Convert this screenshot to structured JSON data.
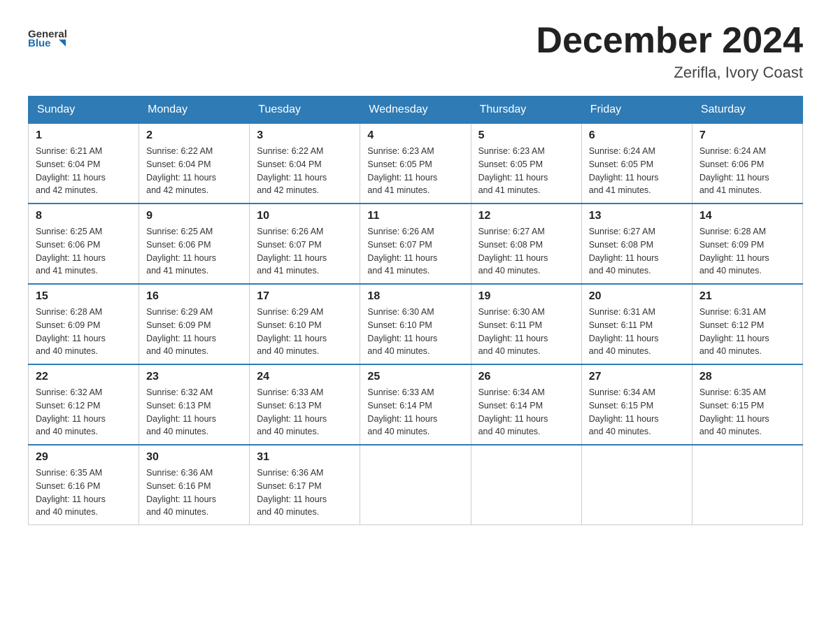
{
  "header": {
    "logo_text_general": "General",
    "logo_text_blue": "Blue",
    "calendar_title": "December 2024",
    "calendar_subtitle": "Zerifla, Ivory Coast"
  },
  "days_of_week": [
    "Sunday",
    "Monday",
    "Tuesday",
    "Wednesday",
    "Thursday",
    "Friday",
    "Saturday"
  ],
  "weeks": [
    [
      {
        "day": "1",
        "sunrise": "6:21 AM",
        "sunset": "6:04 PM",
        "daylight": "11 hours and 42 minutes."
      },
      {
        "day": "2",
        "sunrise": "6:22 AM",
        "sunset": "6:04 PM",
        "daylight": "11 hours and 42 minutes."
      },
      {
        "day": "3",
        "sunrise": "6:22 AM",
        "sunset": "6:04 PM",
        "daylight": "11 hours and 42 minutes."
      },
      {
        "day": "4",
        "sunrise": "6:23 AM",
        "sunset": "6:05 PM",
        "daylight": "11 hours and 41 minutes."
      },
      {
        "day": "5",
        "sunrise": "6:23 AM",
        "sunset": "6:05 PM",
        "daylight": "11 hours and 41 minutes."
      },
      {
        "day": "6",
        "sunrise": "6:24 AM",
        "sunset": "6:05 PM",
        "daylight": "11 hours and 41 minutes."
      },
      {
        "day": "7",
        "sunrise": "6:24 AM",
        "sunset": "6:06 PM",
        "daylight": "11 hours and 41 minutes."
      }
    ],
    [
      {
        "day": "8",
        "sunrise": "6:25 AM",
        "sunset": "6:06 PM",
        "daylight": "11 hours and 41 minutes."
      },
      {
        "day": "9",
        "sunrise": "6:25 AM",
        "sunset": "6:06 PM",
        "daylight": "11 hours and 41 minutes."
      },
      {
        "day": "10",
        "sunrise": "6:26 AM",
        "sunset": "6:07 PM",
        "daylight": "11 hours and 41 minutes."
      },
      {
        "day": "11",
        "sunrise": "6:26 AM",
        "sunset": "6:07 PM",
        "daylight": "11 hours and 41 minutes."
      },
      {
        "day": "12",
        "sunrise": "6:27 AM",
        "sunset": "6:08 PM",
        "daylight": "11 hours and 40 minutes."
      },
      {
        "day": "13",
        "sunrise": "6:27 AM",
        "sunset": "6:08 PM",
        "daylight": "11 hours and 40 minutes."
      },
      {
        "day": "14",
        "sunrise": "6:28 AM",
        "sunset": "6:09 PM",
        "daylight": "11 hours and 40 minutes."
      }
    ],
    [
      {
        "day": "15",
        "sunrise": "6:28 AM",
        "sunset": "6:09 PM",
        "daylight": "11 hours and 40 minutes."
      },
      {
        "day": "16",
        "sunrise": "6:29 AM",
        "sunset": "6:09 PM",
        "daylight": "11 hours and 40 minutes."
      },
      {
        "day": "17",
        "sunrise": "6:29 AM",
        "sunset": "6:10 PM",
        "daylight": "11 hours and 40 minutes."
      },
      {
        "day": "18",
        "sunrise": "6:30 AM",
        "sunset": "6:10 PM",
        "daylight": "11 hours and 40 minutes."
      },
      {
        "day": "19",
        "sunrise": "6:30 AM",
        "sunset": "6:11 PM",
        "daylight": "11 hours and 40 minutes."
      },
      {
        "day": "20",
        "sunrise": "6:31 AM",
        "sunset": "6:11 PM",
        "daylight": "11 hours and 40 minutes."
      },
      {
        "day": "21",
        "sunrise": "6:31 AM",
        "sunset": "6:12 PM",
        "daylight": "11 hours and 40 minutes."
      }
    ],
    [
      {
        "day": "22",
        "sunrise": "6:32 AM",
        "sunset": "6:12 PM",
        "daylight": "11 hours and 40 minutes."
      },
      {
        "day": "23",
        "sunrise": "6:32 AM",
        "sunset": "6:13 PM",
        "daylight": "11 hours and 40 minutes."
      },
      {
        "day": "24",
        "sunrise": "6:33 AM",
        "sunset": "6:13 PM",
        "daylight": "11 hours and 40 minutes."
      },
      {
        "day": "25",
        "sunrise": "6:33 AM",
        "sunset": "6:14 PM",
        "daylight": "11 hours and 40 minutes."
      },
      {
        "day": "26",
        "sunrise": "6:34 AM",
        "sunset": "6:14 PM",
        "daylight": "11 hours and 40 minutes."
      },
      {
        "day": "27",
        "sunrise": "6:34 AM",
        "sunset": "6:15 PM",
        "daylight": "11 hours and 40 minutes."
      },
      {
        "day": "28",
        "sunrise": "6:35 AM",
        "sunset": "6:15 PM",
        "daylight": "11 hours and 40 minutes."
      }
    ],
    [
      {
        "day": "29",
        "sunrise": "6:35 AM",
        "sunset": "6:16 PM",
        "daylight": "11 hours and 40 minutes."
      },
      {
        "day": "30",
        "sunrise": "6:36 AM",
        "sunset": "6:16 PM",
        "daylight": "11 hours and 40 minutes."
      },
      {
        "day": "31",
        "sunrise": "6:36 AM",
        "sunset": "6:17 PM",
        "daylight": "11 hours and 40 minutes."
      },
      null,
      null,
      null,
      null
    ]
  ],
  "labels": {
    "sunrise": "Sunrise:",
    "sunset": "Sunset:",
    "daylight": "Daylight:"
  }
}
